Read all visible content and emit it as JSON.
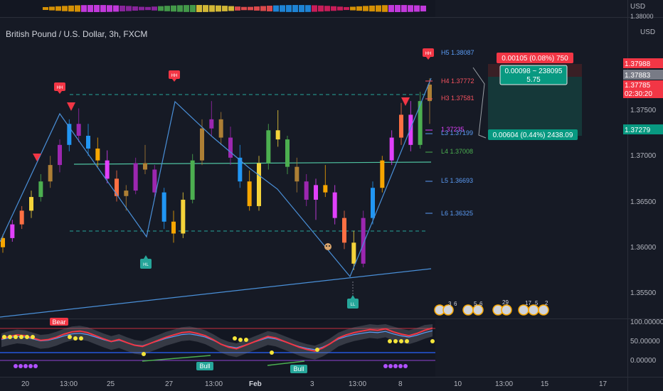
{
  "chart_data": {
    "type": "candlestick",
    "title": "British Pound / U.S. Dollar, 3h, FXCM",
    "currency_label": "USD",
    "price_axis_ticks": [
      "1.37500",
      "1.37000",
      "1.36500",
      "1.36000",
      "1.35500"
    ],
    "time_axis_ticks": [
      "20",
      "13:00",
      "25",
      "27",
      "13:00",
      "Feb",
      "3",
      "13:00",
      "8",
      "10",
      "13:00",
      "15",
      "17"
    ],
    "top_panel_tick": "1.38000",
    "price_tags": [
      {
        "value": "1.37988",
        "color": "#f23645"
      },
      {
        "value": "1.37883",
        "color": "#787b86"
      },
      {
        "value": "1.37785",
        "color": "#f23645"
      },
      {
        "value": "02:30:20",
        "color": "#f23645"
      },
      {
        "value": "1.37279",
        "color": "#089981"
      }
    ],
    "pivot_levels": [
      {
        "label": "H5 1.38087",
        "color": "#5b9cf6"
      },
      {
        "label": "H4 1.37772",
        "color": "#f7525f"
      },
      {
        "label": "H3 1.37581",
        "color": "#f7525f"
      },
      {
        "label": "L3 1.37199",
        "color": "#5b9cf6"
      },
      {
        "label": "L4 1.37008",
        "color": "#4caf50"
      },
      {
        "label": "L5 1.36693",
        "color": "#5b9cf6"
      },
      {
        "label": "L6 1.36325",
        "color": "#5b9cf6"
      }
    ],
    "partial_level_label": "1.37235",
    "pattern_labels": {
      "hh": "HH",
      "hl": "HL",
      "ll": "LL"
    },
    "position_tool": {
      "target": "0.00105 (0.08%) 750",
      "ratio_line1": "0.00098 ~ 238095",
      "ratio_line2": "5.75",
      "stop": "0.00604 (0.44%) 2438.09"
    },
    "event_badges": [
      "3",
      "6",
      "5",
      "6",
      "29",
      "17",
      "5",
      "2"
    ],
    "oscillator": {
      "ticks": [
        "100.00000",
        "50.00000",
        "0.00000"
      ],
      "labels": {
        "bear": "Bear",
        "bull1": "Bull",
        "bull2": "Bull"
      }
    },
    "candles_series": [
      [
        1.36,
        1.3614,
        1.3594,
        1.361
      ],
      [
        1.361,
        1.363,
        1.3606,
        1.3625
      ],
      [
        1.3625,
        1.3645,
        1.362,
        1.364
      ],
      [
        1.364,
        1.3662,
        1.3632,
        1.3655
      ],
      [
        1.3655,
        1.368,
        1.365,
        1.3672
      ],
      [
        1.3672,
        1.37,
        1.3665,
        1.369
      ],
      [
        1.369,
        1.3718,
        1.3682,
        1.3712
      ],
      [
        1.3712,
        1.374,
        1.3705,
        1.3735
      ],
      [
        1.3735,
        1.3752,
        1.3715,
        1.3722
      ],
      [
        1.3722,
        1.3735,
        1.37,
        1.3708
      ],
      [
        1.3708,
        1.372,
        1.3688,
        1.3695
      ],
      [
        1.3695,
        1.3706,
        1.367,
        1.3675
      ],
      [
        1.3675,
        1.3684,
        1.365,
        1.3656
      ],
      [
        1.3656,
        1.3668,
        1.364,
        1.3662
      ],
      [
        1.3662,
        1.3698,
        1.3658,
        1.3692
      ],
      [
        1.3692,
        1.3712,
        1.368,
        1.3685
      ],
      [
        1.3685,
        1.369,
        1.3655,
        1.366
      ],
      [
        1.366,
        1.3665,
        1.362,
        1.3628
      ],
      [
        1.3628,
        1.364,
        1.3605,
        1.3615
      ],
      [
        1.3615,
        1.366,
        1.361,
        1.3652
      ],
      [
        1.3652,
        1.3702,
        1.3648,
        1.3695
      ],
      [
        1.3695,
        1.374,
        1.369,
        1.373
      ],
      [
        1.373,
        1.376,
        1.3722,
        1.374
      ],
      [
        1.374,
        1.3748,
        1.3712,
        1.372
      ],
      [
        1.372,
        1.3732,
        1.369,
        1.3698
      ],
      [
        1.3698,
        1.3712,
        1.3665,
        1.3672
      ],
      [
        1.3672,
        1.3684,
        1.364,
        1.3645
      ],
      [
        1.3645,
        1.37,
        1.364,
        1.3692
      ],
      [
        1.3692,
        1.3735,
        1.3685,
        1.3728
      ],
      [
        1.3728,
        1.375,
        1.371,
        1.3718
      ],
      [
        1.3718,
        1.3722,
        1.368,
        1.3688
      ],
      [
        1.3688,
        1.3698,
        1.366,
        1.3672
      ],
      [
        1.3672,
        1.368,
        1.3645,
        1.3652
      ],
      [
        1.3652,
        1.3675,
        1.363,
        1.3668
      ],
      [
        1.3668,
        1.369,
        1.3655,
        1.366
      ],
      [
        1.366,
        1.3668,
        1.3625,
        1.3632
      ],
      [
        1.3632,
        1.364,
        1.3598,
        1.3605
      ],
      [
        1.3605,
        1.3618,
        1.3575,
        1.3582
      ],
      [
        1.3582,
        1.364,
        1.3578,
        1.3632
      ],
      [
        1.3632,
        1.3672,
        1.3625,
        1.3665
      ],
      [
        1.3665,
        1.37,
        1.366,
        1.3695
      ],
      [
        1.3695,
        1.3728,
        1.369,
        1.372
      ],
      [
        1.372,
        1.3758,
        1.3712,
        1.3745
      ],
      [
        1.3745,
        1.376,
        1.3705,
        1.3712
      ],
      [
        1.3712,
        1.377,
        1.3708,
        1.376
      ],
      [
        1.376,
        1.3785,
        1.3735,
        1.3778
      ]
    ],
    "oscillator_series": [
      62,
      68,
      72,
      70,
      64,
      58,
      60,
      66,
      74,
      80,
      82,
      78,
      70,
      62,
      55,
      60,
      52,
      45,
      42,
      50,
      58,
      66,
      72,
      78,
      80,
      76,
      70,
      60,
      48,
      40,
      36,
      44,
      52,
      60,
      68,
      64,
      56,
      48,
      40,
      34,
      30,
      38,
      50,
      64,
      72,
      78,
      82,
      86,
      84,
      88,
      80,
      74,
      70,
      76,
      84,
      90
    ]
  }
}
